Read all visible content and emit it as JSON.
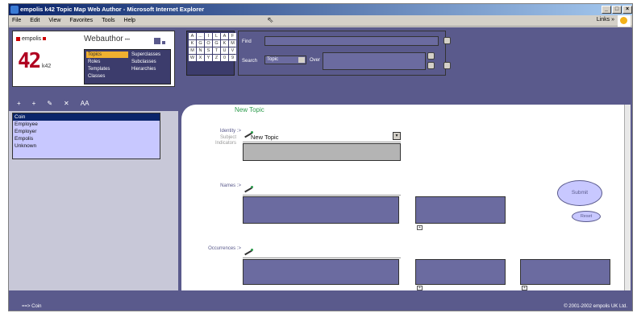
{
  "window": {
    "title": "empolis k42 Topic Map Web Author - Microsoft Internet Explorer",
    "buttons": [
      "_",
      "□",
      "×"
    ]
  },
  "menubar": {
    "items": [
      "File",
      "Edit",
      "View",
      "Favorites",
      "Tools",
      "Help"
    ],
    "links_label": "Links »"
  },
  "header": {
    "brand": "empolis",
    "logo_big": "42",
    "logo_small": "k42",
    "app_title": "Webauthor",
    "app_title_suffix": "•••"
  },
  "nav": {
    "items": [
      {
        "label": "Topics",
        "active": true
      },
      {
        "label": "Superclasses",
        "active": false
      },
      {
        "label": "Roles",
        "active": false
      },
      {
        "label": "Subclasses",
        "active": false
      },
      {
        "label": "Templates",
        "active": false
      },
      {
        "label": "Hierarchies",
        "active": false
      },
      {
        "label": "Classes",
        "active": false
      }
    ]
  },
  "alpha": [
    "A",
    "...",
    "I",
    "L",
    "A",
    "F",
    "K",
    "G",
    "O",
    "G",
    "K",
    "M",
    "M",
    "N",
    "S",
    "T",
    "U",
    "V",
    "W",
    "X",
    "Y",
    "Z",
    "0",
    "9"
  ],
  "find": {
    "find_label": "Find",
    "search_label": "Search",
    "search_type": "Topic",
    "over_label": "Over"
  },
  "toolbar": {
    "items": [
      "+",
      "+",
      "✎",
      "✕",
      "AA"
    ]
  },
  "topic_list": {
    "items": [
      {
        "label": "Coin",
        "selected": true
      },
      {
        "label": "Employee",
        "selected": false
      },
      {
        "label": "Employer",
        "selected": false
      },
      {
        "label": "Empolis",
        "selected": false
      },
      {
        "label": "Unknown",
        "selected": false
      }
    ]
  },
  "content": {
    "heading": "New Topic",
    "identity_label": "Identity :>",
    "subject_label_1": "Subject",
    "subject_label_2": "Indicators",
    "identity_value": "New Topic",
    "names_label": "Names :>",
    "occurrences_label": "Occurrences :>",
    "submit_label": "Submit",
    "reset_label": "Reset"
  },
  "status": {
    "left": "==> Coin",
    "right": "© 2001-2002 empolis UK Ltd."
  }
}
